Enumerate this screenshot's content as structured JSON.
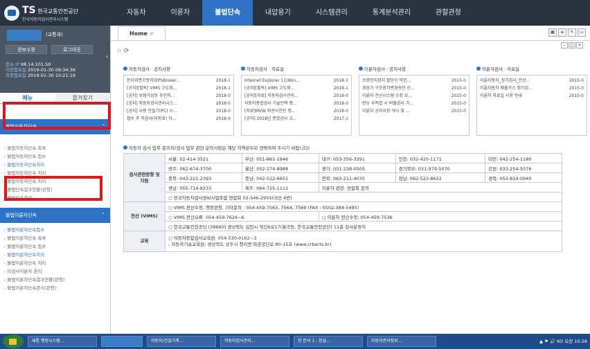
{
  "brand": {
    "name": "TS",
    "org": "한국교통안전공단",
    "sub": "한국자동차검사관리시스템"
  },
  "nav": [
    "자동차",
    "이륜차",
    "불법단속",
    "내압용기",
    "시스템관리",
    "통계분석관리",
    "관할관청"
  ],
  "user": {
    "role": "(교통과)",
    "btn1": "정보수정",
    "btn2": "로그아웃",
    "ip_label": "접속 IP",
    "ip": "98.14.101.50",
    "last_label": "이전접속일",
    "last": "2019-01-30 09:34:36",
    "now_label": "최종접속일",
    "now": "2019-01-30 10:21:19",
    "collapse": "‹"
  },
  "left_tabs": [
    "메뉴",
    "즐겨찾기"
  ],
  "sec1": {
    "title": "불법자동차단속",
    "items": [
      "- 불법자동차단속 목록",
      "- 불법자동차단속 접수",
      "- 불법자동차단속처리",
      "- 불법자동차단속 처리",
      "- 불법자동차단속 처리",
      "- 불법단속결과현황(관청)",
      "- 불법단속관리"
    ]
  },
  "sec2": {
    "title": "불법이륜차단속",
    "items": [
      "- 불법이륜차단속접수",
      "- 불법이륜차단속 목록",
      "- 불법이륜차단속 접수",
      "- 불법이륜차단속처리",
      "- 불법이륜차단속 처리",
      "- 미검사이륜차 관리",
      "- 불법이륜차단속결과현황(관청)",
      "- 불법이륜차단속관리(관청)"
    ]
  },
  "tab": {
    "label": "Home",
    "close": "×"
  },
  "boards": [
    {
      "title": "자동차검사 · 공지사항",
      "rows": [
        [
          "문서위변조방지(EPSBroker...",
          "2018-1"
        ],
        [
          "[공지][필독] VIMS 고도화...",
          "2018-1"
        ],
        [
          "[공지] 보험가입등 추진하...",
          "2018-0"
        ],
        [
          "[공지] 자동차검사관리시스...",
          "2018-0"
        ],
        [
          "[공지] 사용 안될기(PC) 시...",
          "2018-0"
        ],
        [
          "접수 후 미검사(미완료) 처...",
          "2018-0"
        ]
      ]
    },
    {
      "title": "자동차검사 · 자료실",
      "rows": [
        [
          "Internet Explorer 11(Win...",
          "2018-1"
        ],
        [
          "[공지][필독] VIMS 고도화...",
          "2018-1"
        ],
        [
          "[공지][자료] 자동차검사관리...",
          "2018-0"
        ],
        [
          "자동차종합검사 기술인력 평...",
          "2018-0"
        ],
        [
          "[자료]MVW 외관사진인 정...",
          "2018-0"
        ],
        [
          "[공지] 2018년 종합검사 교...",
          "2017-1"
        ]
      ]
    },
    {
      "title": "이륜자검사 · 공지사항",
      "rows": [
        [
          "소음방지장치 팔단이 막힌...",
          "2015-0"
        ],
        [
          "경음기 구조장치변경승인 신...",
          "2015-0"
        ],
        [
          "이륜차 전산시스템 수정 요...",
          "2015-0"
        ],
        [
          "관능 부적합 시 버출검사 가...",
          "2015-0"
        ],
        [
          "이륜차 공지사항 게시 및 ...",
          "2015-0"
        ]
      ]
    },
    {
      "title": "이륜자검사 · 자료실",
      "rows": [
        [
          "이륜자동차_정기검사_전산...",
          "2015-0"
        ],
        [
          "이륜자동차 배출가스 정기검...",
          "2015-0"
        ],
        [
          "이륜차 자료실 사용 안내",
          "2015-0"
        ]
      ]
    }
  ],
  "contact_title": "자동차 검사 업무 문의처(검사 업무 관련 문의사항은 해당 지역본부로 연락하여 주시기 바랍니다)",
  "contact": {
    "h1": "검사관련방향 및 지원",
    "r1": [
      "서울: 02-414-3521",
      "부산: 051-861-1846",
      "대구: 053-356-3391",
      "인천: 032-420-1171",
      "대전: 042-254-1180"
    ],
    "r2": [
      "광주: 062-674-3700",
      "울산: 052-274-8988",
      "경기: 031-238-0505",
      "경기북부: 031-979-5070",
      "강원: 033-254-5076"
    ],
    "r3": [
      "충북: 043-221-2393",
      "충남: 042-522-6651",
      "전북: 063-211-4035",
      "전남: 062-522-8622",
      "경북: 053-814-0940"
    ],
    "r4": [
      "경남: 055-714-8233",
      "제주: 064-725-1112",
      "이륜자 관련: 연합회 문의"
    ],
    "r5": "○ 전국자동차검사정비사업조합 연합회 02-546-2955(내선 4번)",
    "h2": "전산 (VIMS)",
    "v1": "○ VIMS 전산수정, 행정관청, 기타문의 : 054-459-7563, 7564, 7569 (FAX : 0502-384-5495)",
    "v2": "○ VIMS 전산오류: 054-459-7624~6",
    "v2b": "○ 이륜차 전산수정: 054-459-7536",
    "v3": "○ 한국교통안전공단 (39660) 경상북도 김천시 혁신6로17(율곡동, 한국교통안전공단) 11층 검사운영처",
    "h3": "교육",
    "e1": "○ 자동차종합검사교육원: 054-530-0162~3",
    "e2": "- 자동차기술교육원: 경상북도 상주시 청리면 마공공단로 80-15호 (www.crberts.kr)"
  },
  "taskbar": [
    "새통 행정시스템...",
    "",
    "자동차/건설기계...",
    "자동차검사관리...",
    "한 문서 1 - 한글...",
    "자동차관리정보..."
  ],
  "tray": "▲ ⚑ 🔊 KO  오전 10:26"
}
